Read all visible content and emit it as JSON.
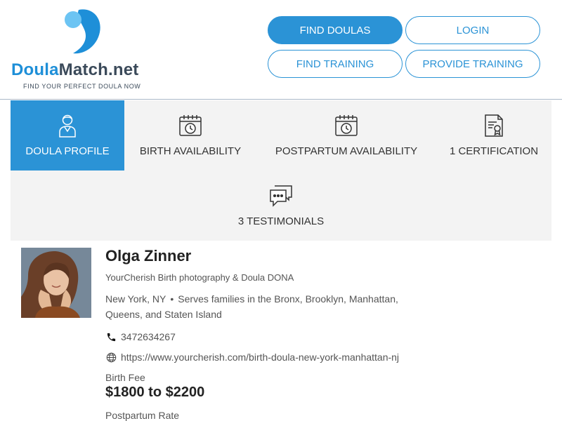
{
  "brand": {
    "name_part1": "Doula",
    "name_part2": "Match.net",
    "tagline": "FIND YOUR PERFECT DOULA NOW",
    "colors": {
      "primary": "#2b93d6",
      "dark": "#3b4a5a"
    }
  },
  "nav": {
    "find_doulas": "FIND DOULAS",
    "login": "LOGIN",
    "find_training": "FIND TRAINING",
    "provide_training": "PROVIDE TRAINING"
  },
  "tabs": [
    {
      "label": "DOULA PROFILE",
      "icon": "doula-person-icon",
      "active": true
    },
    {
      "label": "BIRTH AVAILABILITY",
      "icon": "calendar-clock-icon",
      "active": false
    },
    {
      "label": "POSTPARTUM AVAILABILITY",
      "icon": "calendar-clock-icon",
      "active": false
    },
    {
      "label": "1 CERTIFICATION",
      "icon": "certificate-icon",
      "active": false
    },
    {
      "label": "3 TESTIMONIALS",
      "icon": "chat-bubbles-icon",
      "active": false
    }
  ],
  "profile": {
    "name": "Olga Zinner",
    "organization": "YourCherish Birth photography & Doula DONA",
    "location": "New York, NY",
    "serves": "Serves families in the Bronx, Brooklyn, Manhattan, Queens, and Staten Island",
    "phone": "3472634267",
    "website": "https://www.yourcherish.com/birth-doula-new-york-manhattan-nj",
    "birth_fee_label": "Birth Fee",
    "birth_fee": "$1800 to $2200",
    "postpartum_rate_label": "Postpartum Rate"
  }
}
